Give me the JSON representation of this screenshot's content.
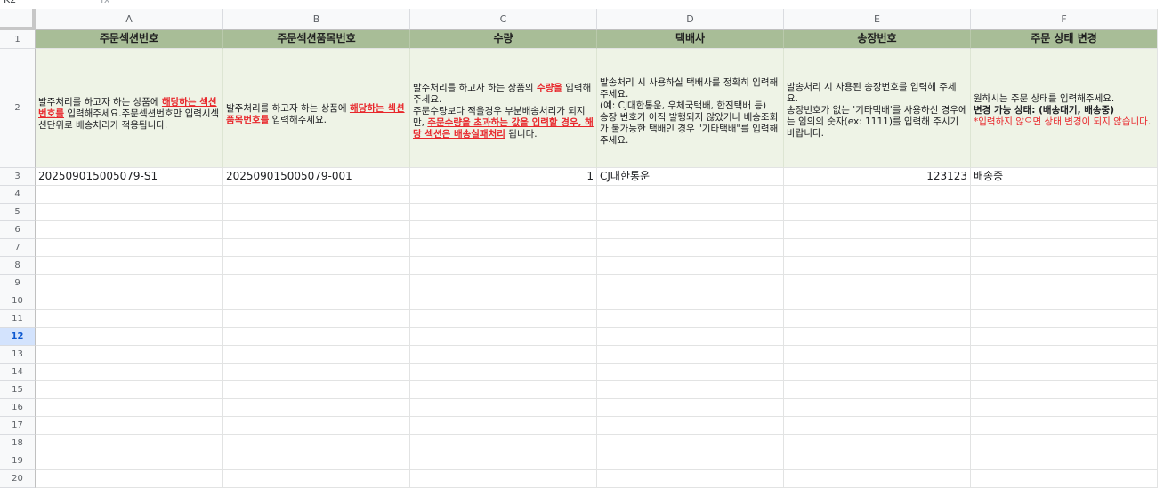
{
  "namebox": "K2",
  "fx_label": "fx",
  "columns": [
    "A",
    "B",
    "C",
    "D",
    "E",
    "F"
  ],
  "rows": [
    "1",
    "2",
    "3",
    "4",
    "5",
    "6",
    "7",
    "8",
    "9",
    "10",
    "11",
    "12",
    "13",
    "14",
    "15",
    "16",
    "17",
    "18",
    "19",
    "20"
  ],
  "selected_row": "12",
  "headers": [
    "주문섹션번호",
    "주문섹션품목번호",
    "수량",
    "택배사",
    "송장번호",
    "주문 상태 변경"
  ],
  "desc": {
    "a": {
      "t1": "발주처리를 하고자 하는 상품에 ",
      "t2": "해당하는 섹션번호를",
      "t3": " 입력해주세요.주문섹션번호만 입력시섹션단위로 배송처리가 적용됩니다."
    },
    "b": {
      "t1": "발주처리를 하고자 하는 상품에 ",
      "t2": "해당하는 섹션품목번호를",
      "t3": " 입력해주세요."
    },
    "c": {
      "t1": "발주처리를 하고자 하는 상품의 ",
      "t2": "수량을",
      "t3": " 입력해주세요.",
      "t4": "주문수량보다 적을경우 부분배송처리가 되지만, ",
      "t5": "주문수량을 초과하는 값을 입력할 경우, 해당 섹션은 배송실패처리",
      "t6": " 됩니다."
    },
    "d": {
      "l1": "발송처리 시 사용하실 택배사를 정확히 입력해 주세요.",
      "l2": "(예: CJ대한통운, 우체국택배, 한진택배 등)",
      "l3": "송장 번호가 아직 발행되지 않았거나 배송조회가 불가능한 택배인 경우 \"기타택배\"를 입력해주세요."
    },
    "e": {
      "l1": "발송처리 시 사용된 송장번호를 입력해 주세요.",
      "l2": " 송장번호가 없는 '기타택배'를 사용하신 경우에는 임의의 숫자(ex: 1111)를 입력해 주시기 바랍니다."
    },
    "f": {
      "l1": "원하시는 주문 상태를 입력해주세요.",
      "l2": "변경 가능 상태: (배송대기, 배송중)",
      "l3": "*입력하지 않으면 상태 변경이 되지 않습니다."
    }
  },
  "data_row": [
    "202509015005079-S1",
    "202509015005079-001",
    "1",
    "CJ대한통운",
    "123123",
    "배송중"
  ],
  "colors": {
    "header_bg": "#a8bd97",
    "desc_bg": "#eef3e6",
    "red": "#e8262b",
    "selected_row_bg": "#d3e3fd"
  }
}
